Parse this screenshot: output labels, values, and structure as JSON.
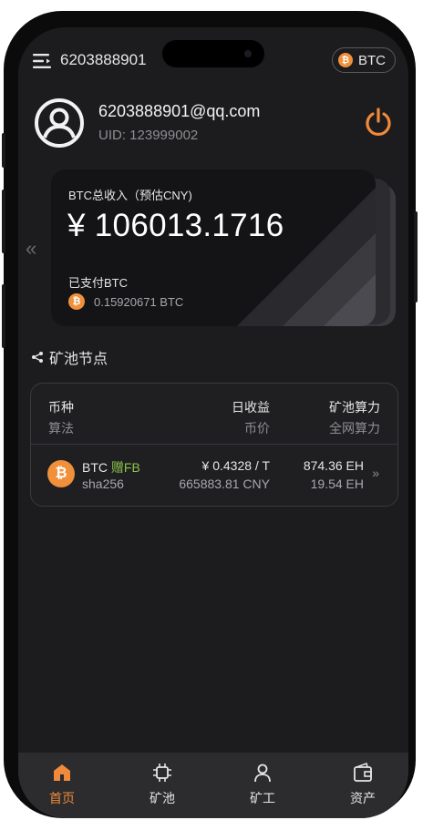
{
  "header": {
    "account_id": "6203888901",
    "coin_selector": "BTC",
    "coin_glyph": "₿"
  },
  "user": {
    "email": "6203888901@qq.com",
    "uid": "UID: 123999002"
  },
  "earnings_card": {
    "label": "BTC总收入（预估CNY)",
    "amount": "¥ 106013.1716",
    "paid_label": "已支付BTC",
    "paid_value": "0.15920671 BTC",
    "coin_glyph": "₿"
  },
  "nav_arrow": "«",
  "section": {
    "title": "矿池节点"
  },
  "pool_table": {
    "headers": {
      "coin": "币种",
      "algorithm": "算法",
      "daily_income": "日收益",
      "coin_price": "币价",
      "pool_hashrate": "矿池算力",
      "network_hashrate": "全网算力"
    },
    "rows": [
      {
        "coin_glyph": "₿",
        "coin": "BTC",
        "bonus": "赠FB",
        "algorithm": "sha256",
        "daily_income": "¥ 0.4328 / T",
        "coin_price": "665883.81 CNY",
        "pool_hashrate": "874.36 EH",
        "network_hashrate": "19.54 EH",
        "chevron": "»"
      }
    ]
  },
  "tabbar": {
    "items": [
      {
        "label": "首页",
        "icon": "home-icon",
        "active": true
      },
      {
        "label": "矿池",
        "icon": "chip-icon",
        "active": false
      },
      {
        "label": "矿工",
        "icon": "person-icon",
        "active": false
      },
      {
        "label": "资产",
        "icon": "wallet-icon",
        "active": false
      }
    ]
  },
  "colors": {
    "accent": "#f08a3a",
    "bonus_green": "#8bc34a",
    "background": "#1c1c1e"
  }
}
